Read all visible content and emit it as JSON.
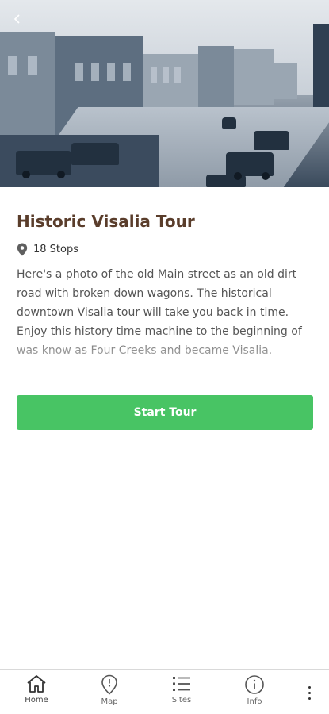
{
  "hero": {
    "back_icon": "chevron-left-icon"
  },
  "tour": {
    "title": "Historic Visalia Tour",
    "stops_label": "18 Stops",
    "stops_icon": "location-pin-icon",
    "description": "Here's a photo of the old Main street as an old dirt road with broken down wagons. The historical downtown Visalia tour will take you back in time. Enjoy this history time machine to the beginning of was know as Four Creeks and became Visalia."
  },
  "actions": {
    "start_label": "Start Tour"
  },
  "nav": {
    "items": [
      {
        "label": "Home",
        "icon": "home-icon"
      },
      {
        "label": "Map",
        "icon": "map-pin-icon"
      },
      {
        "label": "Sites",
        "icon": "list-icon"
      },
      {
        "label": "Info",
        "icon": "info-icon"
      }
    ],
    "more_icon": "more-vertical-icon"
  },
  "colors": {
    "title": "#5a3d2b",
    "accent": "#48c464"
  }
}
